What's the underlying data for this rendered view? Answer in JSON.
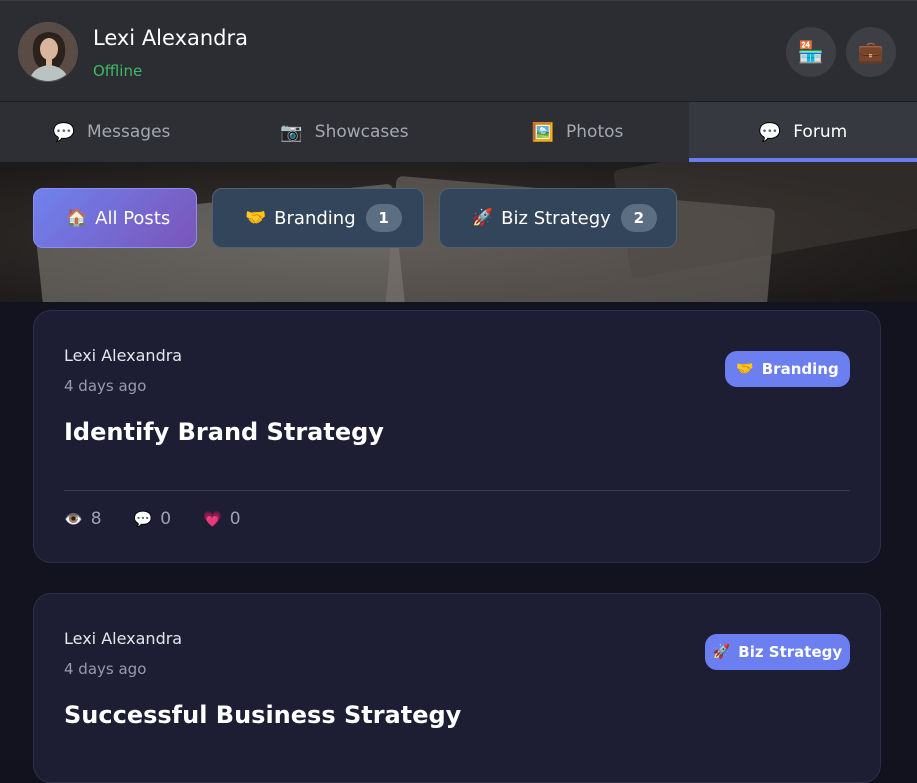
{
  "header": {
    "user_name": "Lexi Alexandra",
    "status": "Offline",
    "status_color": "#3dbb63",
    "store_icon": "🏪",
    "work_icon": "💼"
  },
  "tabs": [
    {
      "label": "Messages",
      "icon": "💬",
      "active": false
    },
    {
      "label": "Showcases",
      "icon": "📷",
      "active": false
    },
    {
      "label": "Photos",
      "icon": "🖼️",
      "active": false
    },
    {
      "label": "Forum",
      "icon": "💬",
      "active": true
    }
  ],
  "filters": [
    {
      "label": "All Posts",
      "icon": "🏠",
      "count": null,
      "active": true
    },
    {
      "label": "Branding",
      "icon": "🤝",
      "count": "1",
      "active": false
    },
    {
      "label": "Biz Strategy",
      "icon": "🚀",
      "count": "2",
      "active": false
    }
  ],
  "posts": [
    {
      "author": "Lexi Alexandra",
      "time": "4 days ago",
      "title": "Identify Brand Strategy",
      "tag": {
        "label": "Branding",
        "icon": "🤝"
      },
      "stats": {
        "views": "8",
        "comments": "0",
        "likes": "0"
      },
      "icons": {
        "views": "👁️",
        "comments": "💬",
        "likes": "💗"
      }
    },
    {
      "author": "Lexi Alexandra",
      "time": "4 days ago",
      "title": "Successful Business Strategy",
      "tag": {
        "label": "Biz Strategy",
        "icon": "🚀"
      }
    }
  ],
  "colors": {
    "accent": "#6c7cf0",
    "tag": "#6b7ff0",
    "card": "#1d1d33"
  }
}
